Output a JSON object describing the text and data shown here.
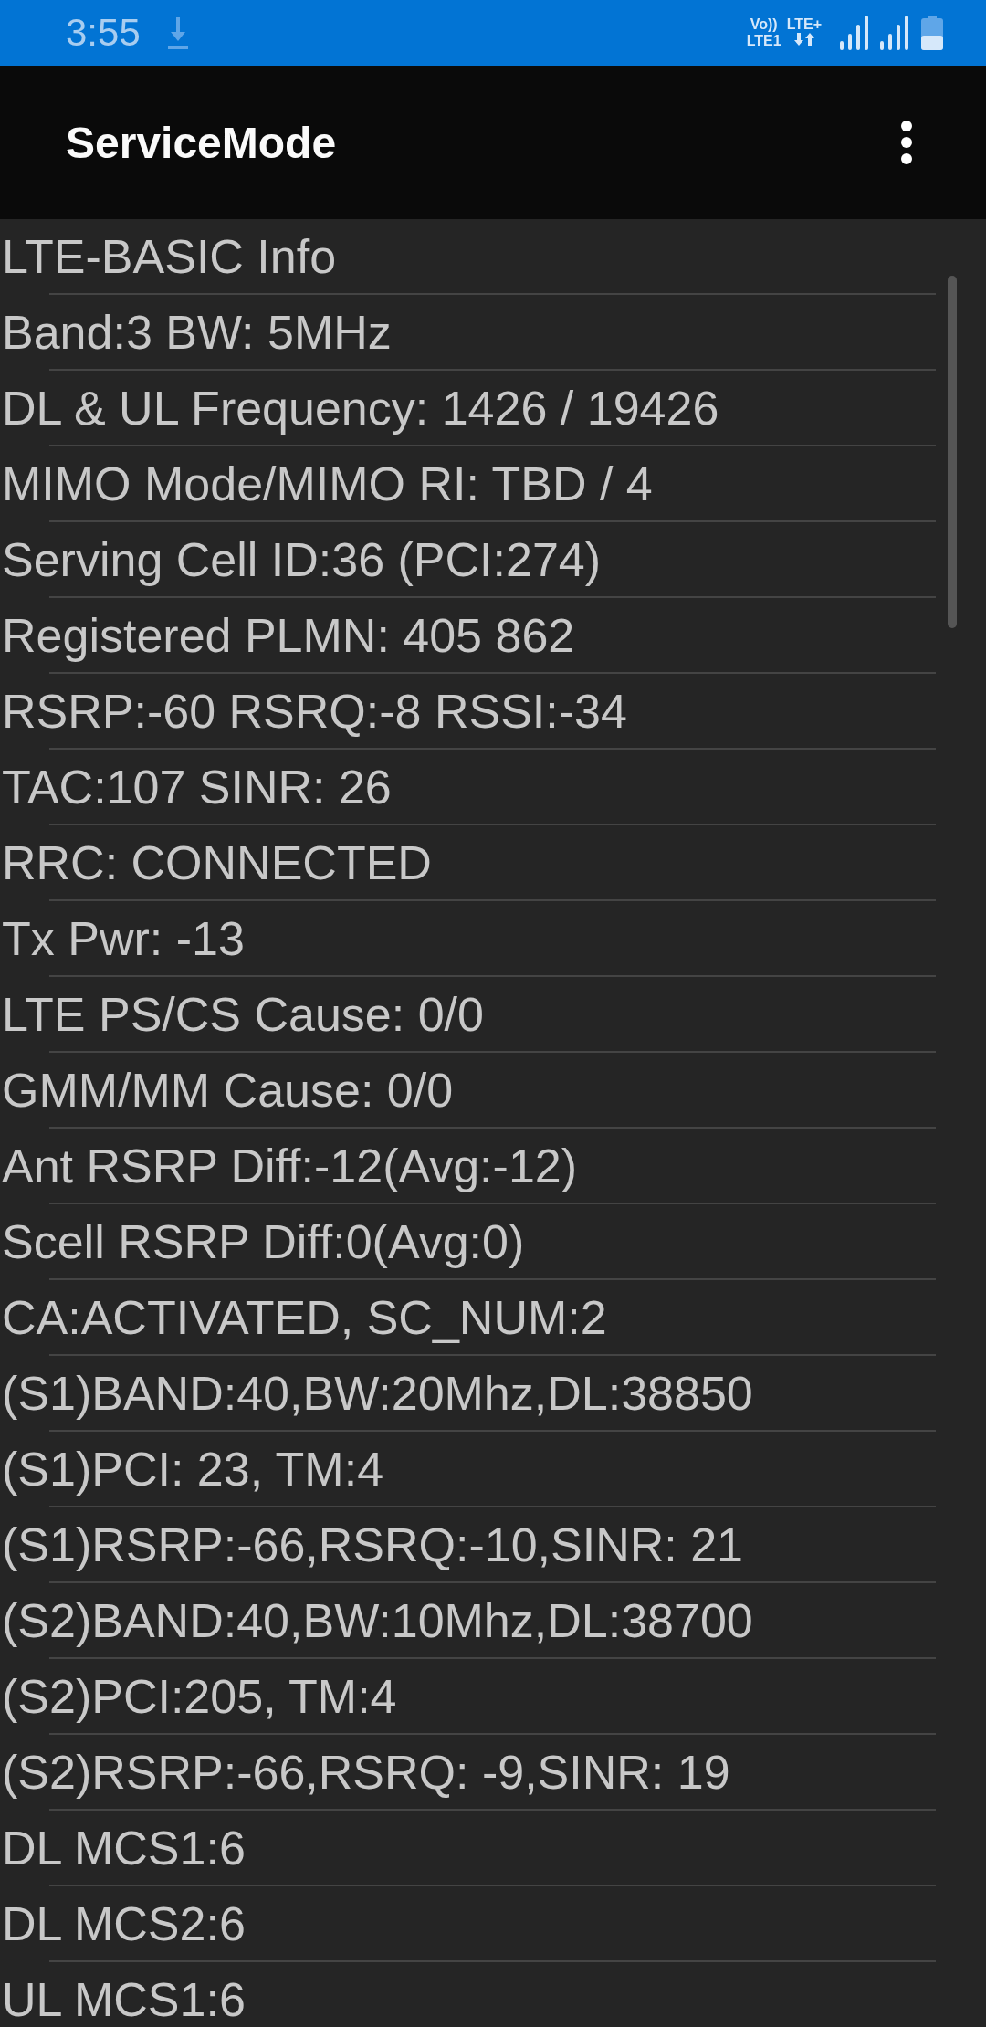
{
  "status_bar": {
    "time": "3:55",
    "volte": "Vo))",
    "sim": "LTE1",
    "network": "LTE+"
  },
  "app_bar": {
    "title": "ServiceMode"
  },
  "info_lines": [
    "LTE-BASIC Info",
    "Band:3 BW: 5MHz",
    "DL & UL Frequency: 1426 / 19426",
    "MIMO Mode/MIMO RI: TBD / 4",
    "Serving Cell ID:36 (PCI:274)",
    "Registered PLMN: 405 862",
    "RSRP:-60 RSRQ:-8 RSSI:-34",
    "TAC:107 SINR: 26",
    "RRC: CONNECTED",
    "Tx Pwr: -13",
    "LTE PS/CS Cause: 0/0",
    "GMM/MM Cause: 0/0",
    "Ant RSRP Diff:-12(Avg:-12)",
    "Scell RSRP Diff:0(Avg:0)",
    "CA:ACTIVATED, SC_NUM:2",
    "(S1)BAND:40,BW:20Mhz,DL:38850",
    "(S1)PCI: 23, TM:4",
    "(S1)RSRP:-66,RSRQ:-10,SINR: 21",
    "(S2)BAND:40,BW:10Mhz,DL:38700",
    "(S2)PCI:205, TM:4",
    "(S2)RSRP:-66,RSRQ: -9,SINR: 19",
    "DL MCS1:6",
    "DL MCS2:6",
    "UL MCS1:6"
  ]
}
